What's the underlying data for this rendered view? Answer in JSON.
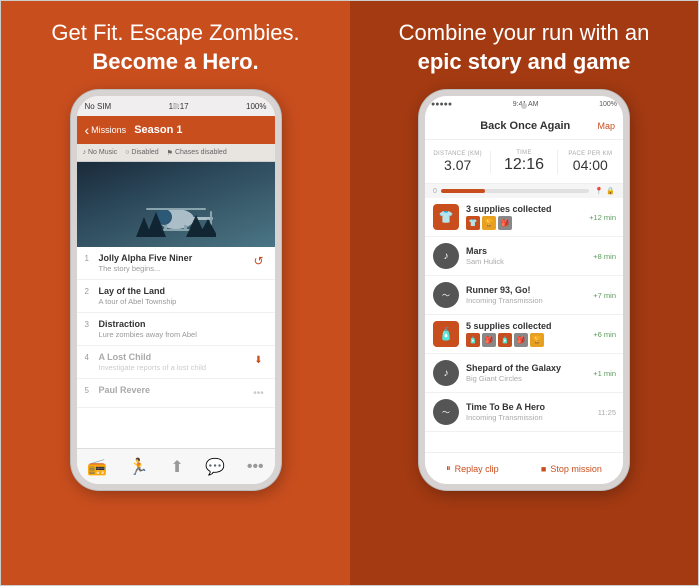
{
  "left": {
    "headline_line1": "Get Fit. Escape Zombies.",
    "headline_line2": "Become a Hero.",
    "phone": {
      "status_bar": {
        "carrier": "No SIM",
        "wifi": "📶",
        "time": "18:17",
        "battery": "100%"
      },
      "nav": {
        "back_label": "Missions",
        "title": "Season 1"
      },
      "sub_toolbar": {
        "music": "No Music",
        "chases": "Disabled",
        "chases_label": "Chases disabled"
      },
      "missions": [
        {
          "number": "1",
          "name": "Jolly Alpha Five Niner",
          "desc": "The story begins...",
          "active": true,
          "icon": "refresh"
        },
        {
          "number": "2",
          "name": "Lay of the Land",
          "desc": "A tour of Abel Township",
          "active": true,
          "icon": "none"
        },
        {
          "number": "3",
          "name": "Distraction",
          "desc": "Lure zombies away from Abel",
          "active": true,
          "icon": "none"
        },
        {
          "number": "4",
          "name": "A Lost Child",
          "desc": "Investigate reports of a lost child",
          "active": false,
          "icon": "download"
        },
        {
          "number": "5",
          "name": "Paul Revere",
          "desc": "",
          "active": false,
          "icon": "dots"
        }
      ],
      "tabs": [
        "radio",
        "run",
        "share",
        "chat",
        "more"
      ]
    }
  },
  "right": {
    "headline_line1": "Combine your run with an",
    "headline_line2": "epic story and game",
    "phone": {
      "status_bar": {
        "signal": "●●●●●",
        "wifi": "wifi",
        "time": "9:41 AM",
        "battery": "100%"
      },
      "nav": {
        "title": "Back Once Again",
        "map": "Map"
      },
      "stats": {
        "distance_label": "Distance (km)",
        "distance_value": "3.07",
        "time_label": "TIME",
        "time_value": "12:16",
        "pace_label": "Pace per km",
        "pace_value": "04:00"
      },
      "activities": [
        {
          "type": "supply",
          "icon": "shirt",
          "title": "3 supplies collected",
          "badges": [
            "shirt",
            "trophy",
            "bag"
          ],
          "badge_colors": [
            "#c94e1e",
            "#e8a020",
            "#888"
          ],
          "time": "+12 min"
        },
        {
          "type": "audio",
          "icon": "music",
          "title": "Mars",
          "subtitle": "Sam Hulick",
          "time": "+8 min"
        },
        {
          "type": "wave",
          "icon": "wave",
          "title": "Runner 93, Go!",
          "subtitle": "Incoming Transmission",
          "time": "+7 min"
        },
        {
          "type": "supply",
          "icon": "bottle",
          "title": "5 supplies collected",
          "badges": [
            "bottle",
            "bag",
            "bag2",
            "bag3",
            "trophy2"
          ],
          "badge_colors": [
            "#c94e1e",
            "#888",
            "#c94e1e",
            "#888",
            "#e8a020"
          ],
          "time": "+6 min"
        },
        {
          "type": "audio",
          "icon": "music",
          "title": "Shepard of the Galaxy",
          "subtitle": "Big Giant Circles",
          "time": "+1 min"
        },
        {
          "type": "wave",
          "icon": "wave",
          "title": "Time To Be A Hero",
          "subtitle": "Incoming Transmission",
          "time": "11:25"
        }
      ],
      "bottom": {
        "replay_label": "Replay clip",
        "stop_label": "Stop mission"
      }
    }
  }
}
